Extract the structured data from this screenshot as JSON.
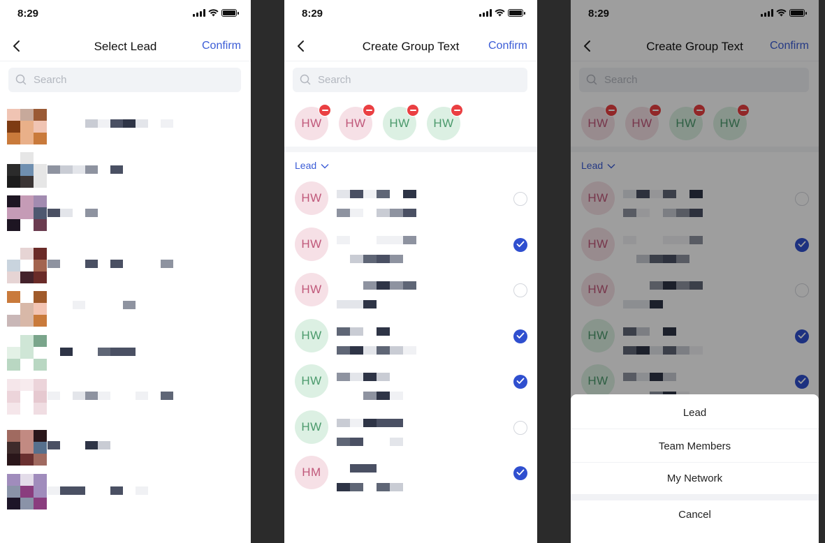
{
  "status": {
    "time": "8:29"
  },
  "screen1": {
    "title": "Select Lead",
    "confirm": "Confirm",
    "search_placeholder": "Search"
  },
  "screen2": {
    "title": "Create Group Text",
    "confirm": "Confirm",
    "search_placeholder": "Search",
    "selected": [
      {
        "initials": "HW",
        "tone": "pink"
      },
      {
        "initials": "HW",
        "tone": "pink"
      },
      {
        "initials": "HW",
        "tone": "green"
      },
      {
        "initials": "HW",
        "tone": "green"
      }
    ],
    "filter_label": "Lead",
    "contacts": [
      {
        "initials": "HW",
        "tone": "pink",
        "checked": false
      },
      {
        "initials": "HW",
        "tone": "pink",
        "checked": true
      },
      {
        "initials": "HW",
        "tone": "pink",
        "checked": false
      },
      {
        "initials": "HW",
        "tone": "green",
        "checked": true
      },
      {
        "initials": "HW",
        "tone": "green",
        "checked": true
      },
      {
        "initials": "HW",
        "tone": "green",
        "checked": false
      },
      {
        "initials": "HM",
        "tone": "pink",
        "checked": true
      }
    ]
  },
  "screen3": {
    "title": "Create Group Text",
    "confirm": "Confirm",
    "search_placeholder": "Search",
    "filter_label": "Lead",
    "sheet_options": [
      "Lead",
      "Team Members",
      "My Network"
    ],
    "sheet_cancel": "Cancel"
  },
  "colors": {
    "accent": "#3b5cd6",
    "checked": "#2f4fcf",
    "remove_badge": "#ea3f42",
    "avatar_pink_bg": "#f6e0e6",
    "avatar_pink_text": "#c0587a",
    "avatar_green_bg": "#dcf0e3",
    "avatar_green_text": "#4b9a6c"
  }
}
